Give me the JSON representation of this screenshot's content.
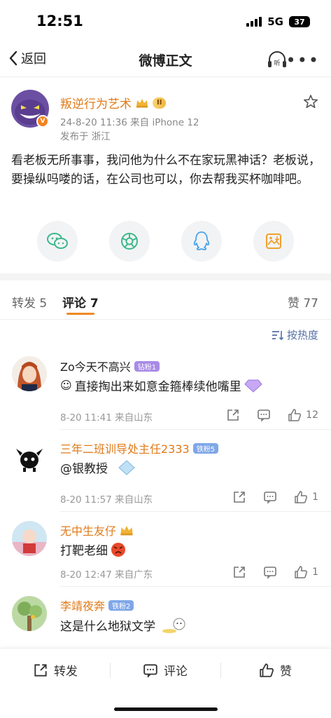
{
  "status_bar": {
    "time": "12:51",
    "network": "5G",
    "battery": "37"
  },
  "nav": {
    "back_label": "返回",
    "title": "微博正文",
    "listen_label": "听"
  },
  "post": {
    "author": "叛逆行为艺术",
    "level_badge": "II",
    "time_device": "24-8-20 11:36  来自 iPhone 12",
    "location": "发布于 浙江",
    "content": "看老板无所事事，我问他为什么不在家玩黑神话？老板说，要操纵吗喽的话，在公司也可以，你去帮我买杯咖啡吧。",
    "share_targets": [
      "wechat-icon",
      "moments-icon",
      "qq-icon",
      "save-image-icon"
    ]
  },
  "tabs": {
    "repost": "转发 5",
    "comment": "评论 7",
    "like": "赞 77"
  },
  "sort_label": "按热度",
  "comments": [
    {
      "name": "Zo今天不高兴",
      "badge": "钻粉1",
      "badge_color": "#a88be6",
      "text": "直接掏出来如意金箍棒续他嘴里",
      "meta": "8-20 11:41  来自山东",
      "likes": "12"
    },
    {
      "name": "三年二班训导处主任2333",
      "badge": "铁粉5",
      "badge_color": "#7fa7e8",
      "text": "@银教授",
      "meta": "8-20 11:57  来自山东",
      "likes": "1"
    },
    {
      "name": "无中生友仔",
      "badge": "",
      "badge_color": "",
      "text": "打靶老细",
      "meta": "8-20 12:47  来自广东",
      "likes": "1"
    },
    {
      "name": "李靖夜奔",
      "badge": "铁粉2",
      "badge_color": "#7fa7e8",
      "text": "这是什么地狱文学",
      "meta": "",
      "likes": ""
    }
  ],
  "bottom_bar": {
    "repost": "转发",
    "comment": "评论",
    "like": "赞"
  },
  "colors": {
    "accent": "#f08a24",
    "name": "#e07a18",
    "link": "#5571a6"
  }
}
